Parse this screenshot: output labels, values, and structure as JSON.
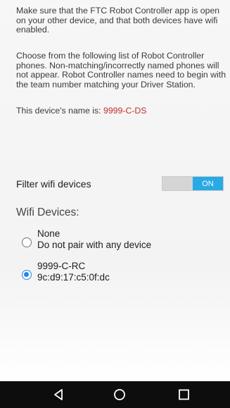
{
  "instructions": {
    "para1": "Make sure that the FTC Robot Controller app is open on your other device, and that both devices have wifi enabled.",
    "para2": "Choose from the following list of Robot Controller phones. Non-matching/incorrectly named phones will not appear. Robot Controller names need to begin with the team number matching your Driver Station.",
    "device_name_label": "This device's name is: ",
    "device_name": "9999-C-DS"
  },
  "filter": {
    "label": "Filter wifi devices",
    "toggle_state": "ON"
  },
  "wifi": {
    "header": "Wifi Devices:",
    "options": [
      {
        "line1": "None",
        "line2": "Do not pair with any device",
        "selected": false
      },
      {
        "line1": "9999-C-RC",
        "line2": "9c:d9:17:c5:0f:dc",
        "selected": true
      }
    ]
  },
  "colors": {
    "toggle_on": "#29a9e6",
    "radio_selected": "#1e88e5",
    "device_name": "#c0302b",
    "navbar": "#0d0d0d"
  },
  "navbar": {
    "icons": [
      "back-icon",
      "home-icon",
      "recent-apps-icon"
    ]
  }
}
